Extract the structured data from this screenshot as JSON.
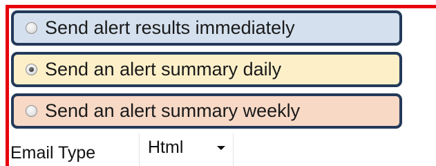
{
  "alert_options": [
    {
      "label": "Send alert results immediately",
      "checked": false,
      "background": "#d4e0ee"
    },
    {
      "label": "Send an alert summary daily",
      "checked": true,
      "background": "#fdf0c9"
    },
    {
      "label": "Send an alert summary weekly",
      "checked": false,
      "background": "#f7d9c6"
    }
  ],
  "email_type": {
    "label": "Email Type",
    "selected": "Html"
  },
  "colors": {
    "frame_red": "#e8000b",
    "option_border": "#243a5a"
  }
}
